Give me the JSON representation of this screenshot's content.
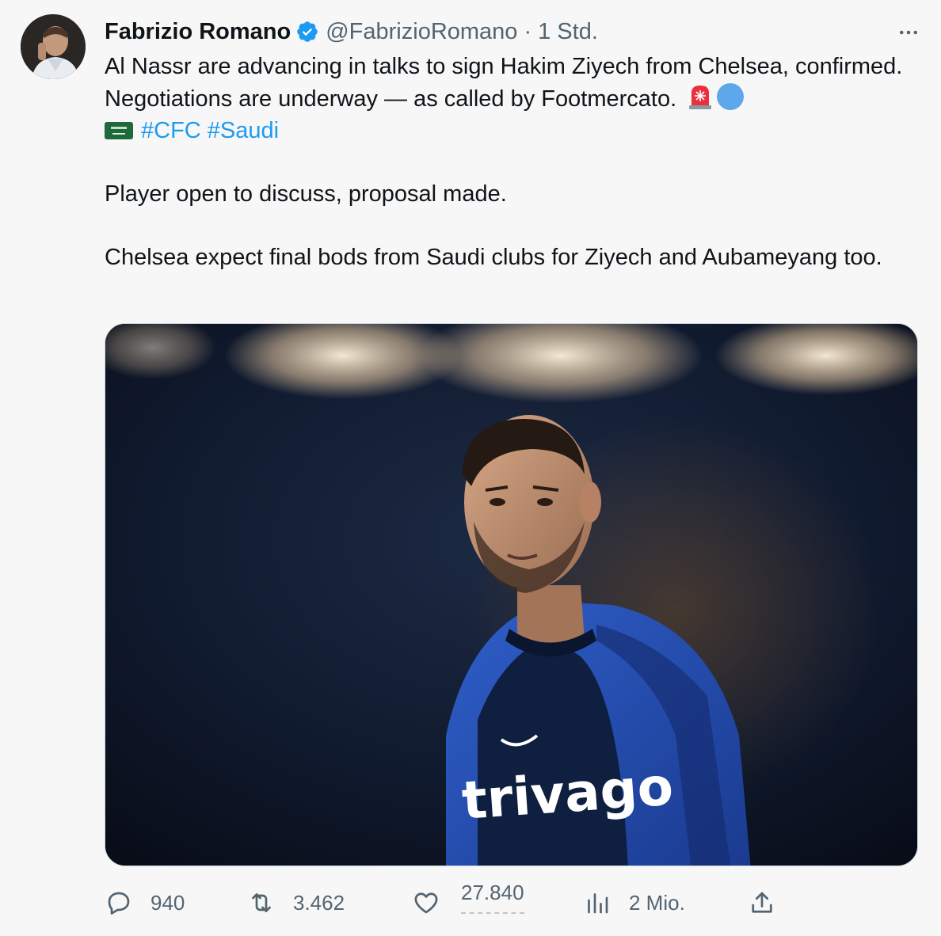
{
  "author": {
    "name": "Fabrizio Romano",
    "handle": "@FabrizioRomano",
    "separator": "·",
    "time": "1 Std.",
    "avatar_icon": "profile-photo",
    "verified_icon": "verified-badge-icon",
    "verified_color": "#1d9bf0"
  },
  "more_icon": "more-horizontal-icon",
  "tweet": {
    "line1_text": "Al Nassr are advancing in talks to sign Hakim Ziyech from Chelsea, confirmed. Negotiations are underway — as called by Footmercato.",
    "emoji_siren": "police-light-emoji",
    "emoji_circle": "blue-circle-emoji",
    "emoji_flag": "saudi-arabia-flag-emoji",
    "hashtag_1": "#CFC",
    "hashtag_2": "#Saudi",
    "paragraph_2": "Player open to discuss, proposal made.",
    "paragraph_3": "Chelsea expect final bods from Saudi clubs for Ziyech and Aubameyang too."
  },
  "media": {
    "description_icon": "football-player-photo",
    "shirt_sponsor": "trivago"
  },
  "actions": {
    "reply": {
      "icon": "reply-icon",
      "count": "940"
    },
    "retweet": {
      "icon": "retweet-icon",
      "count": "3.462"
    },
    "like": {
      "icon": "like-icon",
      "count": "27.840"
    },
    "views": {
      "icon": "views-icon",
      "count": "2 Mio."
    },
    "share": {
      "icon": "share-icon"
    }
  },
  "colors": {
    "link": "#1d9bf0",
    "text": "#0f1419",
    "muted": "#536471",
    "background": "#f7f7f7"
  }
}
